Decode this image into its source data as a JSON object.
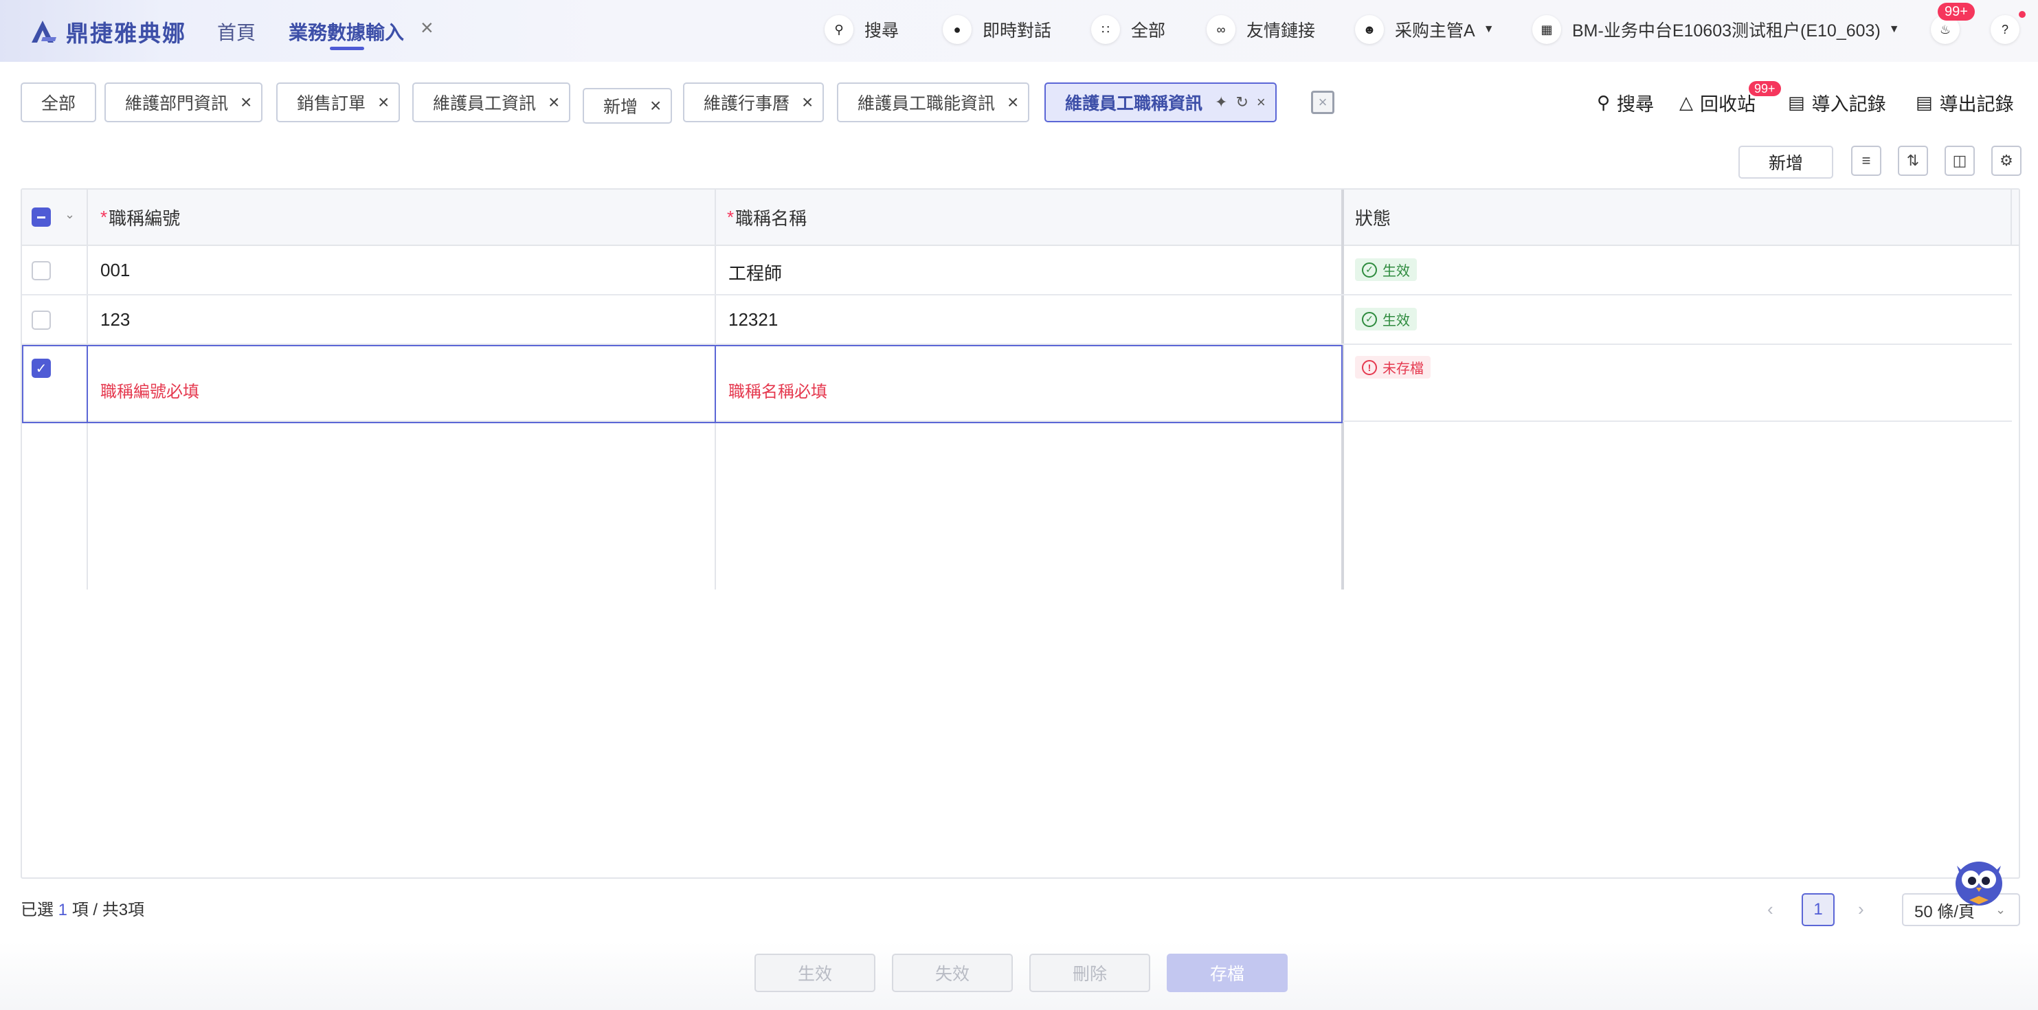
{
  "app": {
    "logo_text": "鼎捷雅典娜",
    "nav_home": "首頁",
    "nav_active": "業務數據輸入",
    "nav_close": "×"
  },
  "topbar": {
    "search": "搜尋",
    "chat": "即時對話",
    "all": "全部",
    "links": "友情鏈接",
    "user": "采购主管A",
    "tenant": "BM-业务中台E10603测试租户(E10_603)",
    "notif_badge": "99+"
  },
  "tabs": [
    {
      "label": "全部",
      "closable": false
    },
    {
      "label": "維護部門資訊",
      "closable": true
    },
    {
      "label": "銷售訂單",
      "closable": true
    },
    {
      "label": "維護員工資訊",
      "closable": true
    },
    {
      "label": "新增",
      "closable": true
    },
    {
      "label": "維護行事曆",
      "closable": true
    },
    {
      "label": "維護員工職能資訊",
      "closable": true
    },
    {
      "label": "維護員工職稱資訊",
      "closable": true,
      "active": true
    }
  ],
  "tools": {
    "search": "搜尋",
    "recycle": "回收站",
    "recycle_badge": "99+",
    "import_log": "導入記錄",
    "export_log": "導出記錄"
  },
  "toolbar": {
    "add_label": "新增"
  },
  "table": {
    "columns": [
      {
        "label": "職稱編號",
        "required": true
      },
      {
        "label": "職稱名稱",
        "required": true
      },
      {
        "label": "狀態",
        "required": false
      }
    ],
    "required_mark": "*",
    "rows": [
      {
        "code": "001",
        "name": "工程師",
        "status": "生效",
        "checked": false
      },
      {
        "code": "123",
        "name": "12321",
        "status": "生效",
        "checked": false
      },
      {
        "code": "",
        "name": "",
        "status": "未存檔",
        "checked": true,
        "code_error": "職稱編號必填",
        "name_error": "職稱名稱必填"
      }
    ]
  },
  "footer": {
    "selected_prefix": "已選",
    "selected_count": "1",
    "selected_suffix": "項 / 共3項",
    "current_page": "1",
    "page_size": "50 條/頁"
  },
  "actions": {
    "activate": "生效",
    "deactivate": "失效",
    "delete": "刪除",
    "save": "存檔"
  },
  "colors": {
    "accent": "#4f5bd5",
    "error": "#e5394f",
    "success": "#2e8b3e",
    "badge": "#f5365c"
  }
}
